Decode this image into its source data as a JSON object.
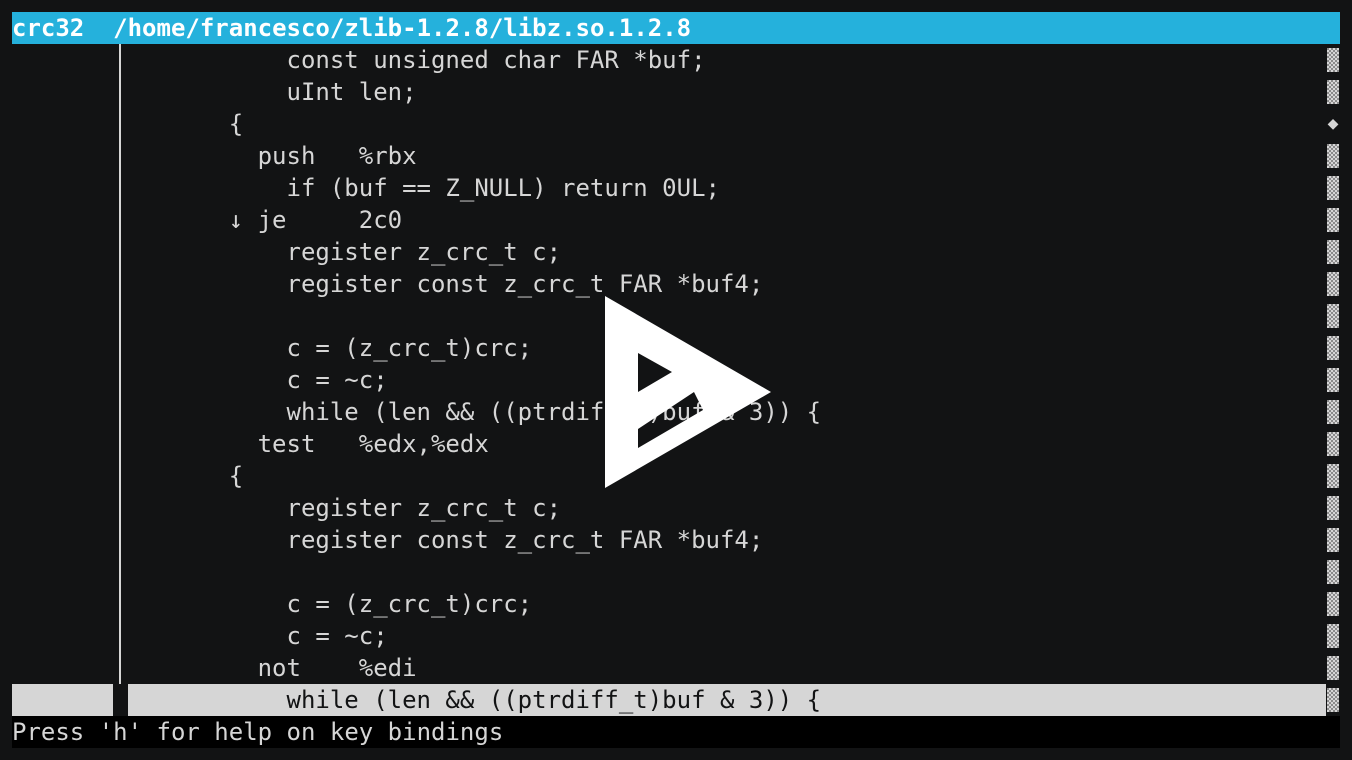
{
  "title_bar": {
    "text": "crc32  /home/francesco/zlib-1.2.8/libz.so.1.2.8"
  },
  "lines": [
    {
      "text": "          const unsigned char FAR *buf;"
    },
    {
      "text": "          uInt len;"
    },
    {
      "text": "      {"
    },
    {
      "text": "        push   %rbx"
    },
    {
      "text": "          if (buf == Z_NULL) return 0UL;"
    },
    {
      "text": "      ↓ je     2c0"
    },
    {
      "text": "          register z_crc_t c;"
    },
    {
      "text": "          register const z_crc_t FAR *buf4;"
    },
    {
      "text": ""
    },
    {
      "text": "          c = (z_crc_t)crc;"
    },
    {
      "text": "          c = ~c;"
    },
    {
      "text": "          while (len && ((ptrdiff_t)buf & 3)) {"
    },
    {
      "text": "        test   %edx,%edx"
    },
    {
      "text": "      {"
    },
    {
      "text": "          register z_crc_t c;"
    },
    {
      "text": "          register const z_crc_t FAR *buf4;"
    },
    {
      "text": ""
    },
    {
      "text": "          c = (z_crc_t)crc;"
    },
    {
      "text": "          c = ~c;"
    },
    {
      "text": "        not    %edi"
    },
    {
      "text": "          while (len && ((ptrdiff_t)buf & 3)) {"
    }
  ],
  "selected_line_index": 20,
  "scrollbar": {
    "thumb_glyph": "◆",
    "thumb_index": 2
  },
  "status_bar": {
    "text": "Press 'h' for help on key bindings"
  },
  "overlay": {
    "icon": "play-logo-icon"
  },
  "colors": {
    "title_bg": "#25b1dc",
    "background": "#121314",
    "foreground": "#d6d6d6",
    "status_bg": "#000000"
  }
}
